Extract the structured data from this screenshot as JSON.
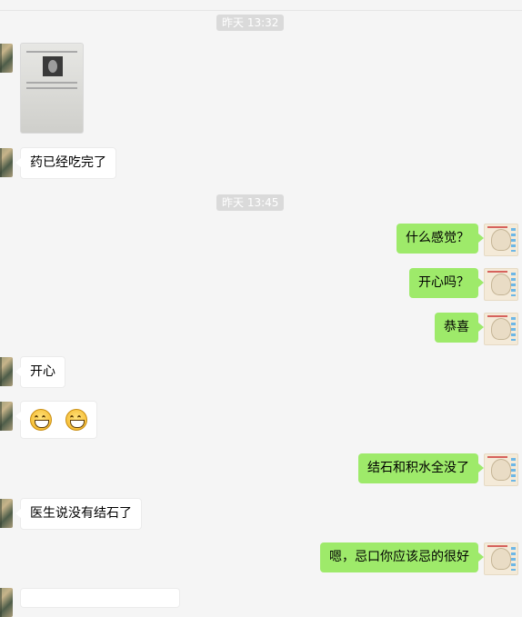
{
  "timestamps": [
    "昨天 13:32",
    "昨天 13:45"
  ],
  "messages": [
    {
      "side": "left",
      "type": "image"
    },
    {
      "side": "left",
      "type": "text",
      "text": "药已经吃完了"
    },
    {
      "side": "right",
      "type": "text",
      "text": "什么感觉？"
    },
    {
      "side": "right",
      "type": "text",
      "text": "开心吗？"
    },
    {
      "side": "right",
      "type": "text",
      "text": "恭喜"
    },
    {
      "side": "left",
      "type": "text",
      "text": "开心"
    },
    {
      "side": "left",
      "type": "emoji",
      "emoji": "grin-face-icon"
    },
    {
      "side": "right",
      "type": "text",
      "text": "结石和积水全没了"
    },
    {
      "side": "left",
      "type": "text",
      "text": "医生说没有结石了"
    },
    {
      "side": "right",
      "type": "text",
      "text": "嗯，忌口你应该忌的很好"
    }
  ],
  "colors": {
    "right_bubble": "#9eea6a",
    "left_bubble": "#ffffff",
    "background": "#f5f5f5",
    "timestamp_bg": "#dadada"
  }
}
